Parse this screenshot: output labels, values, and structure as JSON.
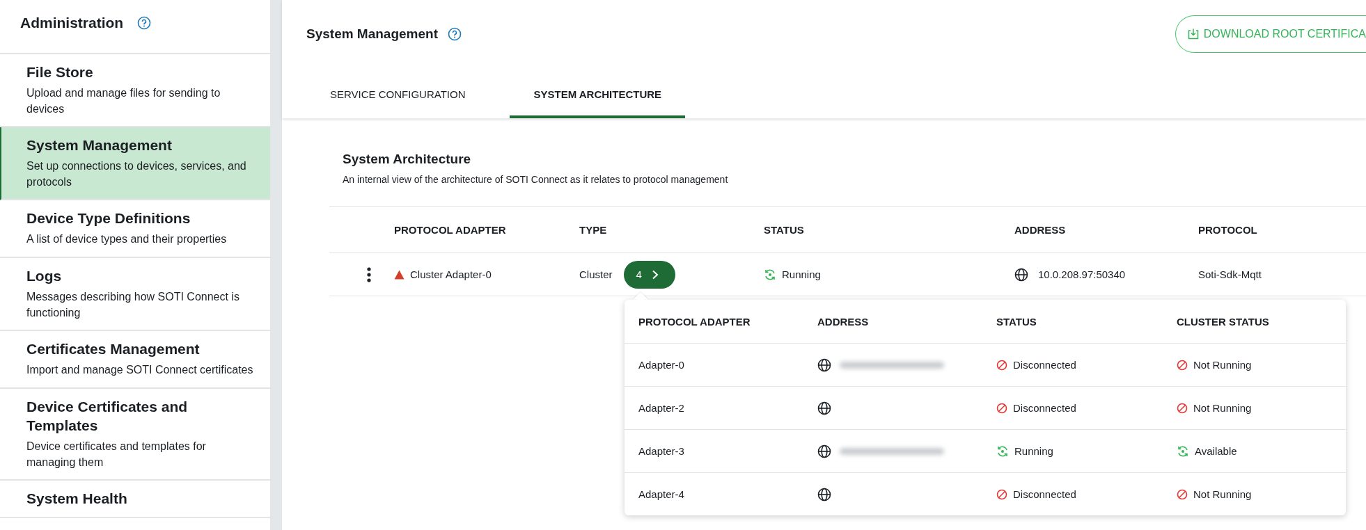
{
  "sidebar": {
    "title": "Administration",
    "items": [
      {
        "title": "File Store",
        "description": "Upload and manage files for sending to devices",
        "selected": false
      },
      {
        "title": "System Management",
        "description": "Set up connections to devices, services, and protocols",
        "selected": true
      },
      {
        "title": "Device Type Definitions",
        "description": "A list of device types and their properties",
        "selected": false
      },
      {
        "title": "Logs",
        "description": "Messages describing how SOTI Connect is functioning",
        "selected": false
      },
      {
        "title": "Certificates Management",
        "description": "Import and manage SOTI Connect certificates",
        "selected": false
      },
      {
        "title": "Device Certificates and Templates",
        "description": "Device certificates and templates for managing them",
        "selected": false
      },
      {
        "title": "System Health",
        "selected": false
      }
    ]
  },
  "header": {
    "title": "System Management",
    "download_button": "DOWNLOAD ROOT CERTIFICA"
  },
  "tabs": [
    {
      "label": "SERVICE CONFIGURATION",
      "selected": false
    },
    {
      "label": "SYSTEM ARCHITECTURE",
      "selected": true
    }
  ],
  "section": {
    "title": "System Architecture",
    "description": "An internal view of the architecture of SOTI Connect as it relates to protocol management"
  },
  "table": {
    "columns": [
      "PROTOCOL ADAPTER",
      "TYPE",
      "STATUS",
      "ADDRESS",
      "PROTOCOL"
    ],
    "rows": [
      {
        "adapter": "Cluster Adapter-0",
        "warning": true,
        "type": "Cluster",
        "count": "4",
        "status": {
          "kind": "running",
          "label": "Running"
        },
        "address": "10.0.208.97:50340",
        "protocol": "Soti-Sdk-Mqtt"
      }
    ]
  },
  "popup": {
    "columns": [
      "PROTOCOL ADAPTER",
      "ADDRESS",
      "STATUS",
      "CLUSTER STATUS"
    ],
    "rows": [
      {
        "adapter": "Adapter-0",
        "address_blurred": true,
        "status": {
          "kind": "disconnected",
          "label": "Disconnected"
        },
        "cluster_status": {
          "kind": "disconnected",
          "label": "Not Running"
        }
      },
      {
        "adapter": "Adapter-2",
        "address_blurred": false,
        "status": {
          "kind": "disconnected",
          "label": "Disconnected"
        },
        "cluster_status": {
          "kind": "disconnected",
          "label": "Not Running"
        }
      },
      {
        "adapter": "Adapter-3",
        "address_blurred": true,
        "status": {
          "kind": "running",
          "label": "Running"
        },
        "cluster_status": {
          "kind": "running",
          "label": "Available"
        }
      },
      {
        "adapter": "Adapter-4",
        "address_blurred": false,
        "status": {
          "kind": "disconnected",
          "label": "Disconnected"
        },
        "cluster_status": {
          "kind": "disconnected",
          "label": "Not Running"
        }
      }
    ]
  }
}
